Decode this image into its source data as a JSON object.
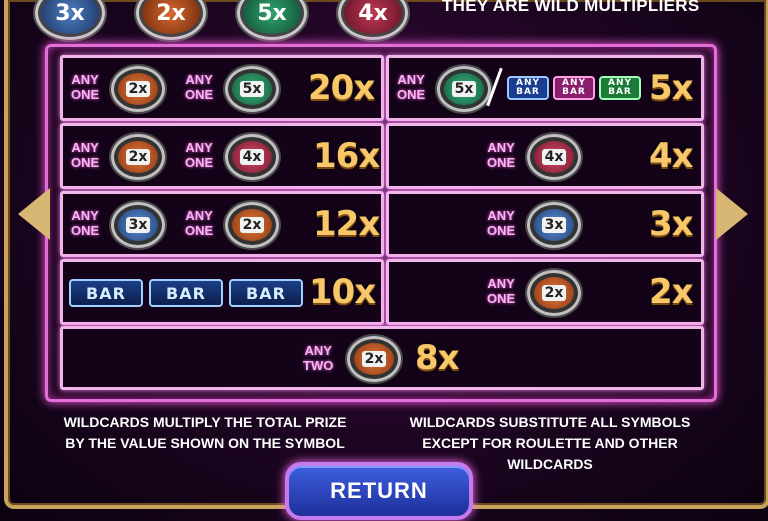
{
  "top_strip": {
    "chips": [
      {
        "mult": "3x",
        "color": "#4d7fc0"
      },
      {
        "mult": "2x",
        "color": "#d46a2f"
      },
      {
        "mult": "5x",
        "color": "#2fa56e"
      },
      {
        "mult": "4x",
        "color": "#c03a55"
      }
    ],
    "caption": "THEY ARE WILD MULTIPLIERS"
  },
  "paytable": {
    "any_one": "ANY\nONE",
    "any_two": "ANY\nTWO",
    "bar_label": "BAR",
    "left": [
      {
        "chips": [
          "2x",
          "5x"
        ],
        "multiplier": "20x"
      },
      {
        "chips": [
          "2x",
          "4x"
        ],
        "multiplier": "16x"
      },
      {
        "chips": [
          "3x",
          "2x"
        ],
        "multiplier": "12x"
      },
      {
        "bars": [
          "BAR",
          "BAR",
          "BAR"
        ],
        "multiplier": "10x"
      }
    ],
    "right": [
      {
        "chip": "5x",
        "any_bar": [
          "ANY BAR",
          "ANY BAR",
          "ANY BAR"
        ],
        "multiplier": "5x"
      },
      {
        "chip": "4x",
        "multiplier": "4x"
      },
      {
        "chip": "3x",
        "multiplier": "3x"
      },
      {
        "chip": "2x",
        "multiplier": "2x"
      }
    ],
    "bottom": {
      "chip": "2x",
      "multiplier": "8x"
    }
  },
  "info_left": [
    "WILDCARDS MULTIPLY THE TOTAL PRIZE",
    "BY THE VALUE SHOWN ON THE SYMBOL"
  ],
  "info_right": [
    "WILDCARDS SUBSTITUTE ALL SYMBOLS",
    "EXCEPT FOR ROULETTE AND OTHER",
    "WILDCARDS"
  ],
  "return_label": "RETURN",
  "colors": {
    "accent_gold": "#f7c76a",
    "neon_pink": "#e26fd8",
    "button_blue": "#2c44c0"
  }
}
